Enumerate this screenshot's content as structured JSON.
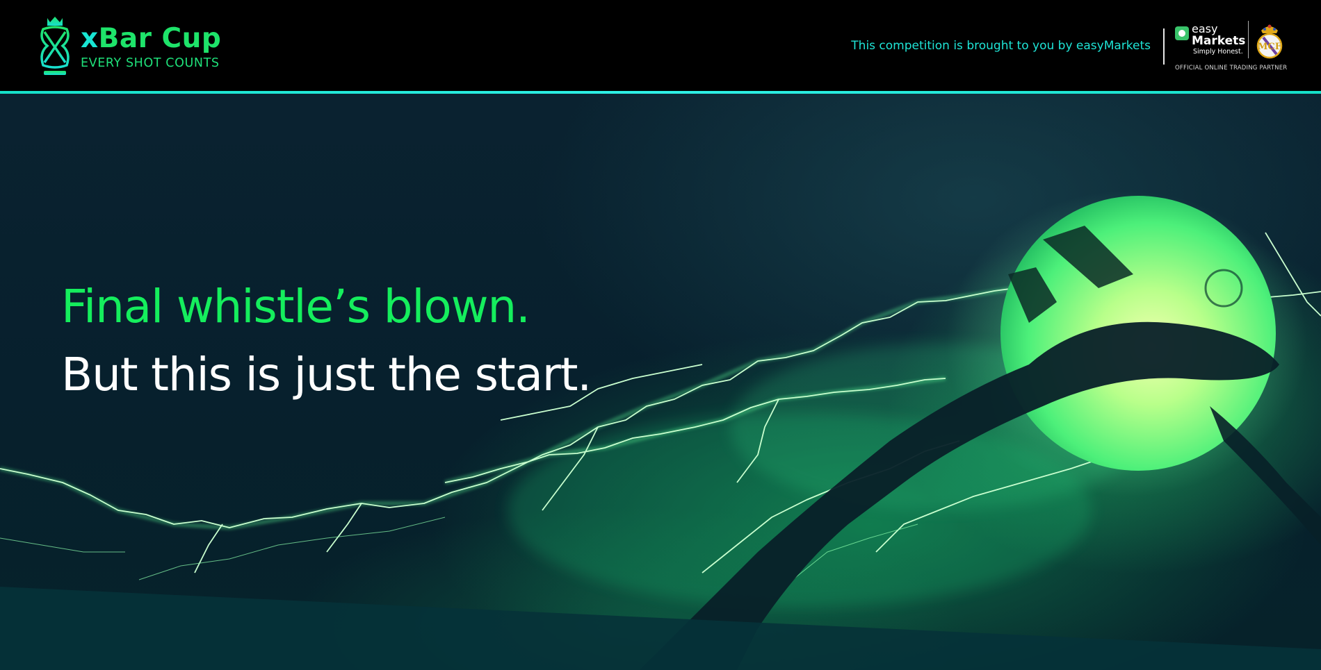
{
  "header": {
    "logo": {
      "prefix": "x",
      "title": "Bar Cup",
      "tagline": "EVERY SHOT COUNTS",
      "icon": "crowned-trophy-icon"
    },
    "sponsor_text": "This competition is brought to you by easyMarkets",
    "sponsor_logo": {
      "easy": "easy",
      "markets": "Markets",
      "tagline": "Simply Honest.",
      "partner_tag": "OFFICIAL ONLINE TRADING PARTNER",
      "crest_icon": "real-madrid-crest-icon"
    },
    "accent_line_color": "#22e8dc"
  },
  "hero": {
    "headline_1": "Final whistle’s blown.",
    "headline_2": "But this is just the start.",
    "image": "glowing-football-with-lightning",
    "colors": {
      "accent_green": "#15ee5d",
      "background": "#07202d"
    }
  }
}
